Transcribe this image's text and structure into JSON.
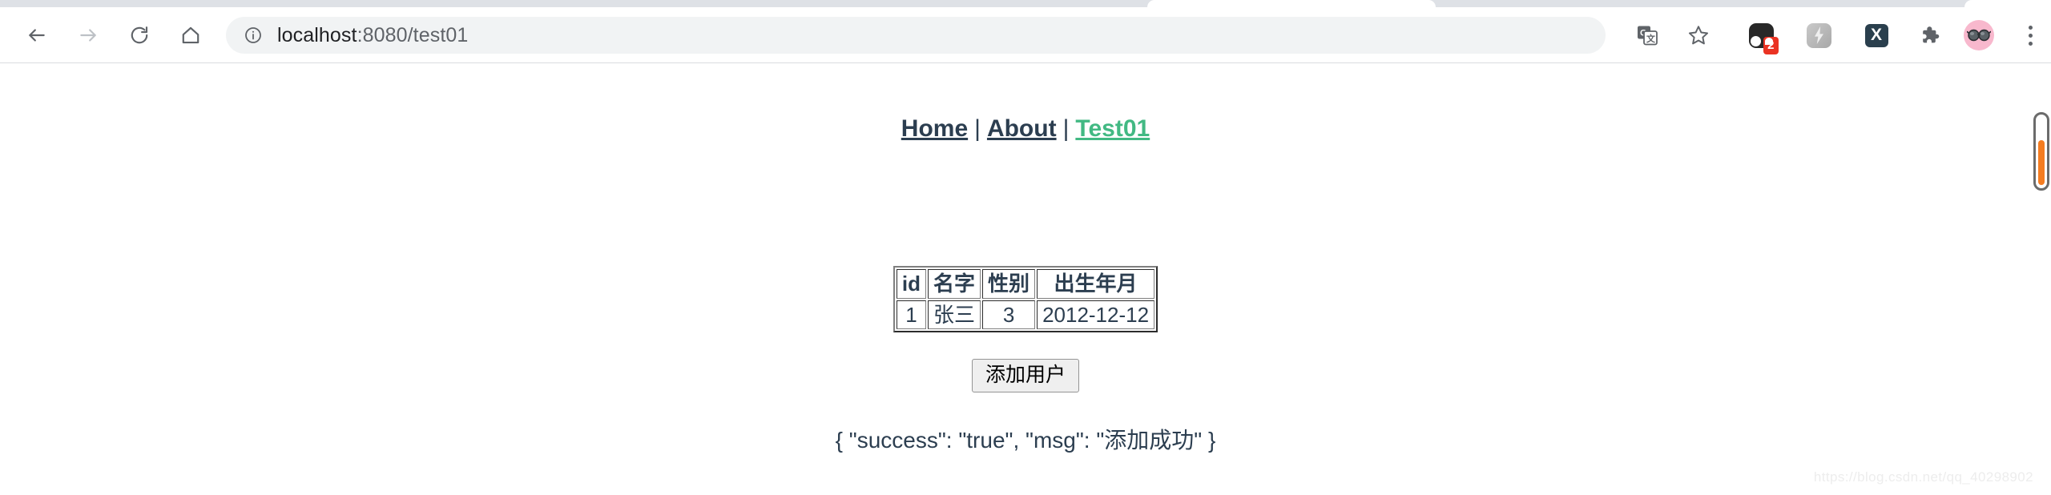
{
  "browser": {
    "nav": {
      "back_label": "Back",
      "forward_label": "Forward",
      "reload_label": "Reload",
      "home_label": "Home"
    },
    "omnibox": {
      "info_icon": "info-circle-icon",
      "url_host": "localhost",
      "url_rest": ":8080/test01",
      "full_url": "localhost:8080/test01"
    },
    "toolbar_icons": [
      {
        "name": "translate-icon",
        "label": "Translate this page"
      },
      {
        "name": "bookmark-star-icon",
        "label": "Bookmark this tab"
      },
      {
        "name": "extension-dark-icon",
        "label": "Extension",
        "badge": "2"
      },
      {
        "name": "extension-lightning-icon",
        "label": "Extension"
      },
      {
        "name": "extension-x-icon",
        "label": "X",
        "glyph": "X"
      },
      {
        "name": "puzzle-extensions-icon",
        "label": "Extensions"
      },
      {
        "name": "profile-avatar",
        "label": "Profile"
      },
      {
        "name": "browser-menu-icon",
        "label": "Customize and control"
      }
    ]
  },
  "page": {
    "nav_links": [
      {
        "label": "Home",
        "active": false
      },
      {
        "label": "About",
        "active": false
      },
      {
        "label": "Test01",
        "active": true
      }
    ],
    "nav_separator": "|",
    "table": {
      "headers": [
        "id",
        "名字",
        "性别",
        "出生年月"
      ],
      "rows": [
        [
          "1",
          "张三",
          "3",
          "2012-12-12"
        ]
      ]
    },
    "add_button_label": "添加用户",
    "result_text": "{ \"success\": \"true\", \"msg\": \"添加成功\" }",
    "watermark": "https://blog.csdn.net/qq_40298902"
  },
  "colors": {
    "link_default": "#2c3e50",
    "link_active": "#42b983",
    "badge_red": "#ea3323",
    "scroll_fill_orange": "#f57c20",
    "avatar_pink": "#f8b8cd"
  }
}
